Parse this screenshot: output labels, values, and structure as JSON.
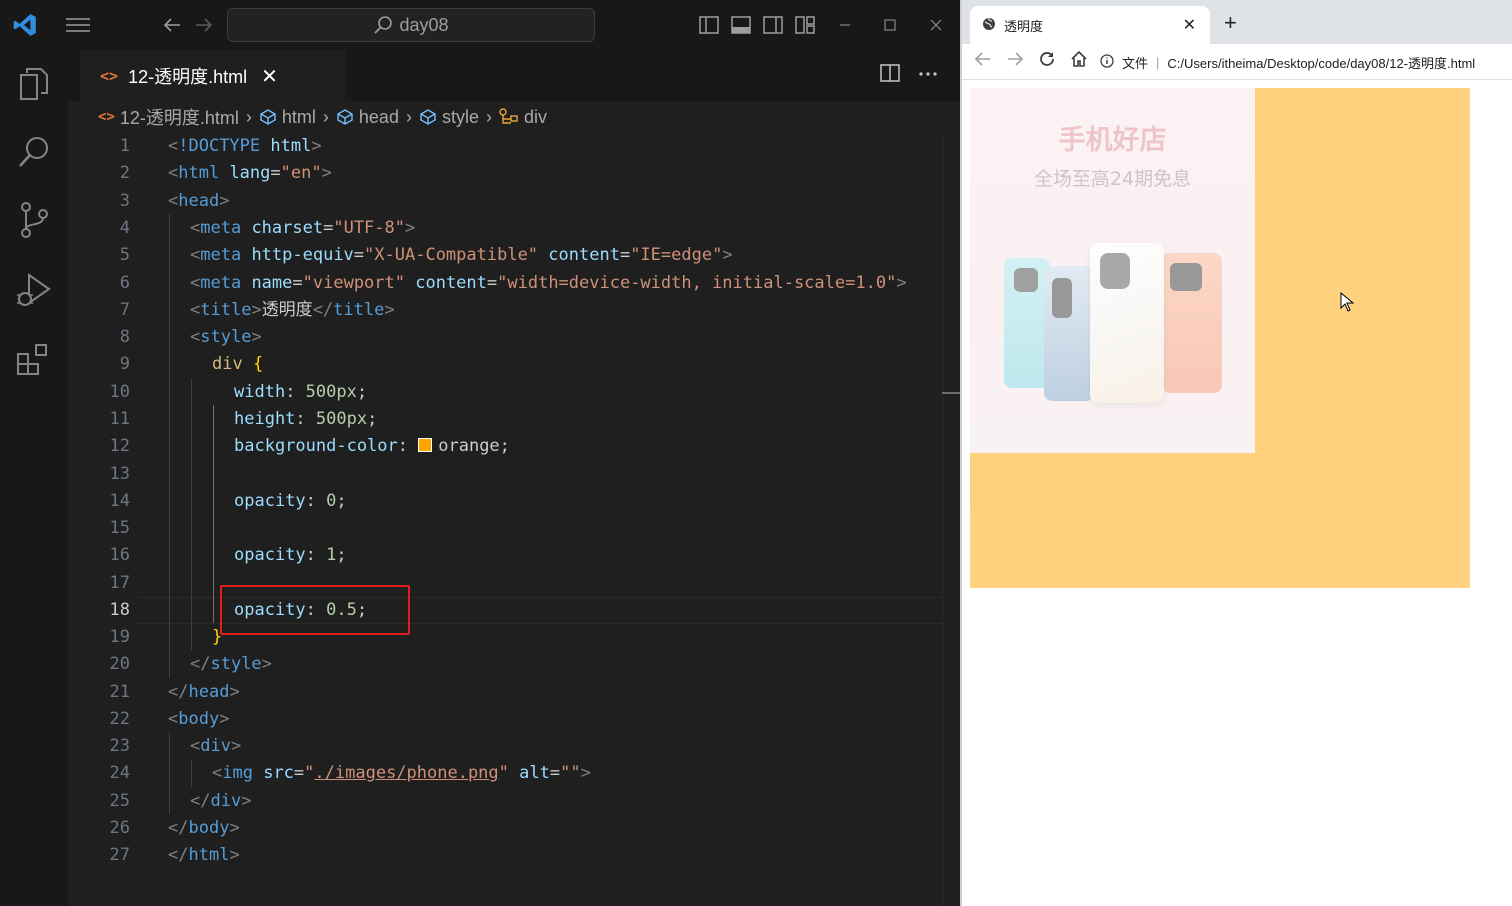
{
  "vscode": {
    "search_label": "day08",
    "tab_title": "12-透明度.html",
    "breadcrumb": [
      "12-透明度.html",
      "html",
      "head",
      "style",
      "div"
    ],
    "line_numbers": [
      "1",
      "2",
      "3",
      "4",
      "5",
      "6",
      "7",
      "8",
      "9",
      "10",
      "11",
      "12",
      "13",
      "14",
      "15",
      "16",
      "17",
      "18",
      "19",
      "20",
      "21",
      "22",
      "23",
      "24",
      "25",
      "26",
      "27"
    ],
    "active_line": "18",
    "code": {
      "l1": [
        "<",
        "!DOCTYPE",
        " html",
        ">"
      ],
      "l2": [
        "<",
        "html",
        " lang",
        "=",
        "\"en\"",
        ">"
      ],
      "l3": [
        "<",
        "head",
        ">"
      ],
      "l4": [
        "<",
        "meta",
        " charset",
        "=",
        "\"UTF-8\"",
        ">"
      ],
      "l5": [
        "<",
        "meta",
        " http-equiv",
        "=",
        "\"X-UA-Compatible\"",
        " content",
        "=",
        "\"IE=edge\"",
        ">"
      ],
      "l6": [
        "<",
        "meta",
        " name",
        "=",
        "\"viewport\"",
        " content",
        "=",
        "\"width=device-width, initial-scale=1.0\"",
        ">"
      ],
      "l7": [
        "<",
        "title",
        ">",
        "透明度",
        "</",
        "title",
        ">"
      ],
      "l8": [
        "<",
        "style",
        ">"
      ],
      "l9": [
        "div",
        " {"
      ],
      "l10": [
        "width",
        ": ",
        "500px",
        ";"
      ],
      "l11": [
        "height",
        ": ",
        "500px",
        ";"
      ],
      "l12": [
        "background-color",
        ": ",
        "orange",
        ";"
      ],
      "l14": [
        "opacity",
        ": ",
        "0",
        ";"
      ],
      "l16": [
        "opacity",
        ": ",
        "1",
        ";"
      ],
      "l18": [
        "opacity",
        ": ",
        "0.5",
        ";"
      ],
      "l19": [
        "}"
      ],
      "l20": [
        "</",
        "style",
        ">"
      ],
      "l21": [
        "</",
        "head",
        ">"
      ],
      "l22": [
        "<",
        "body",
        ">"
      ],
      "l23": [
        "<",
        "div",
        ">"
      ],
      "l24": [
        "<",
        "img",
        " src",
        "=",
        "\"",
        "./images/phone.png",
        "\"",
        " alt",
        "=",
        "\"\"",
        ">"
      ],
      "l25": [
        "</",
        "div",
        ">"
      ],
      "l26": [
        "</",
        "body",
        ">"
      ],
      "l27": [
        "</",
        "html",
        ">"
      ]
    },
    "swatch_color": "#ffa500",
    "highlight_color": "#e01e1e"
  },
  "browser": {
    "tab_title": "透明度",
    "addr_prefix": "文件",
    "url": "C:/Users/itheima/Desktop/code/day08/12-透明度.html",
    "image": {
      "title": "手机好店",
      "subtitle": "全场至高24期免息"
    },
    "div_color": "#ffa500",
    "div_opacity": 0.5
  }
}
